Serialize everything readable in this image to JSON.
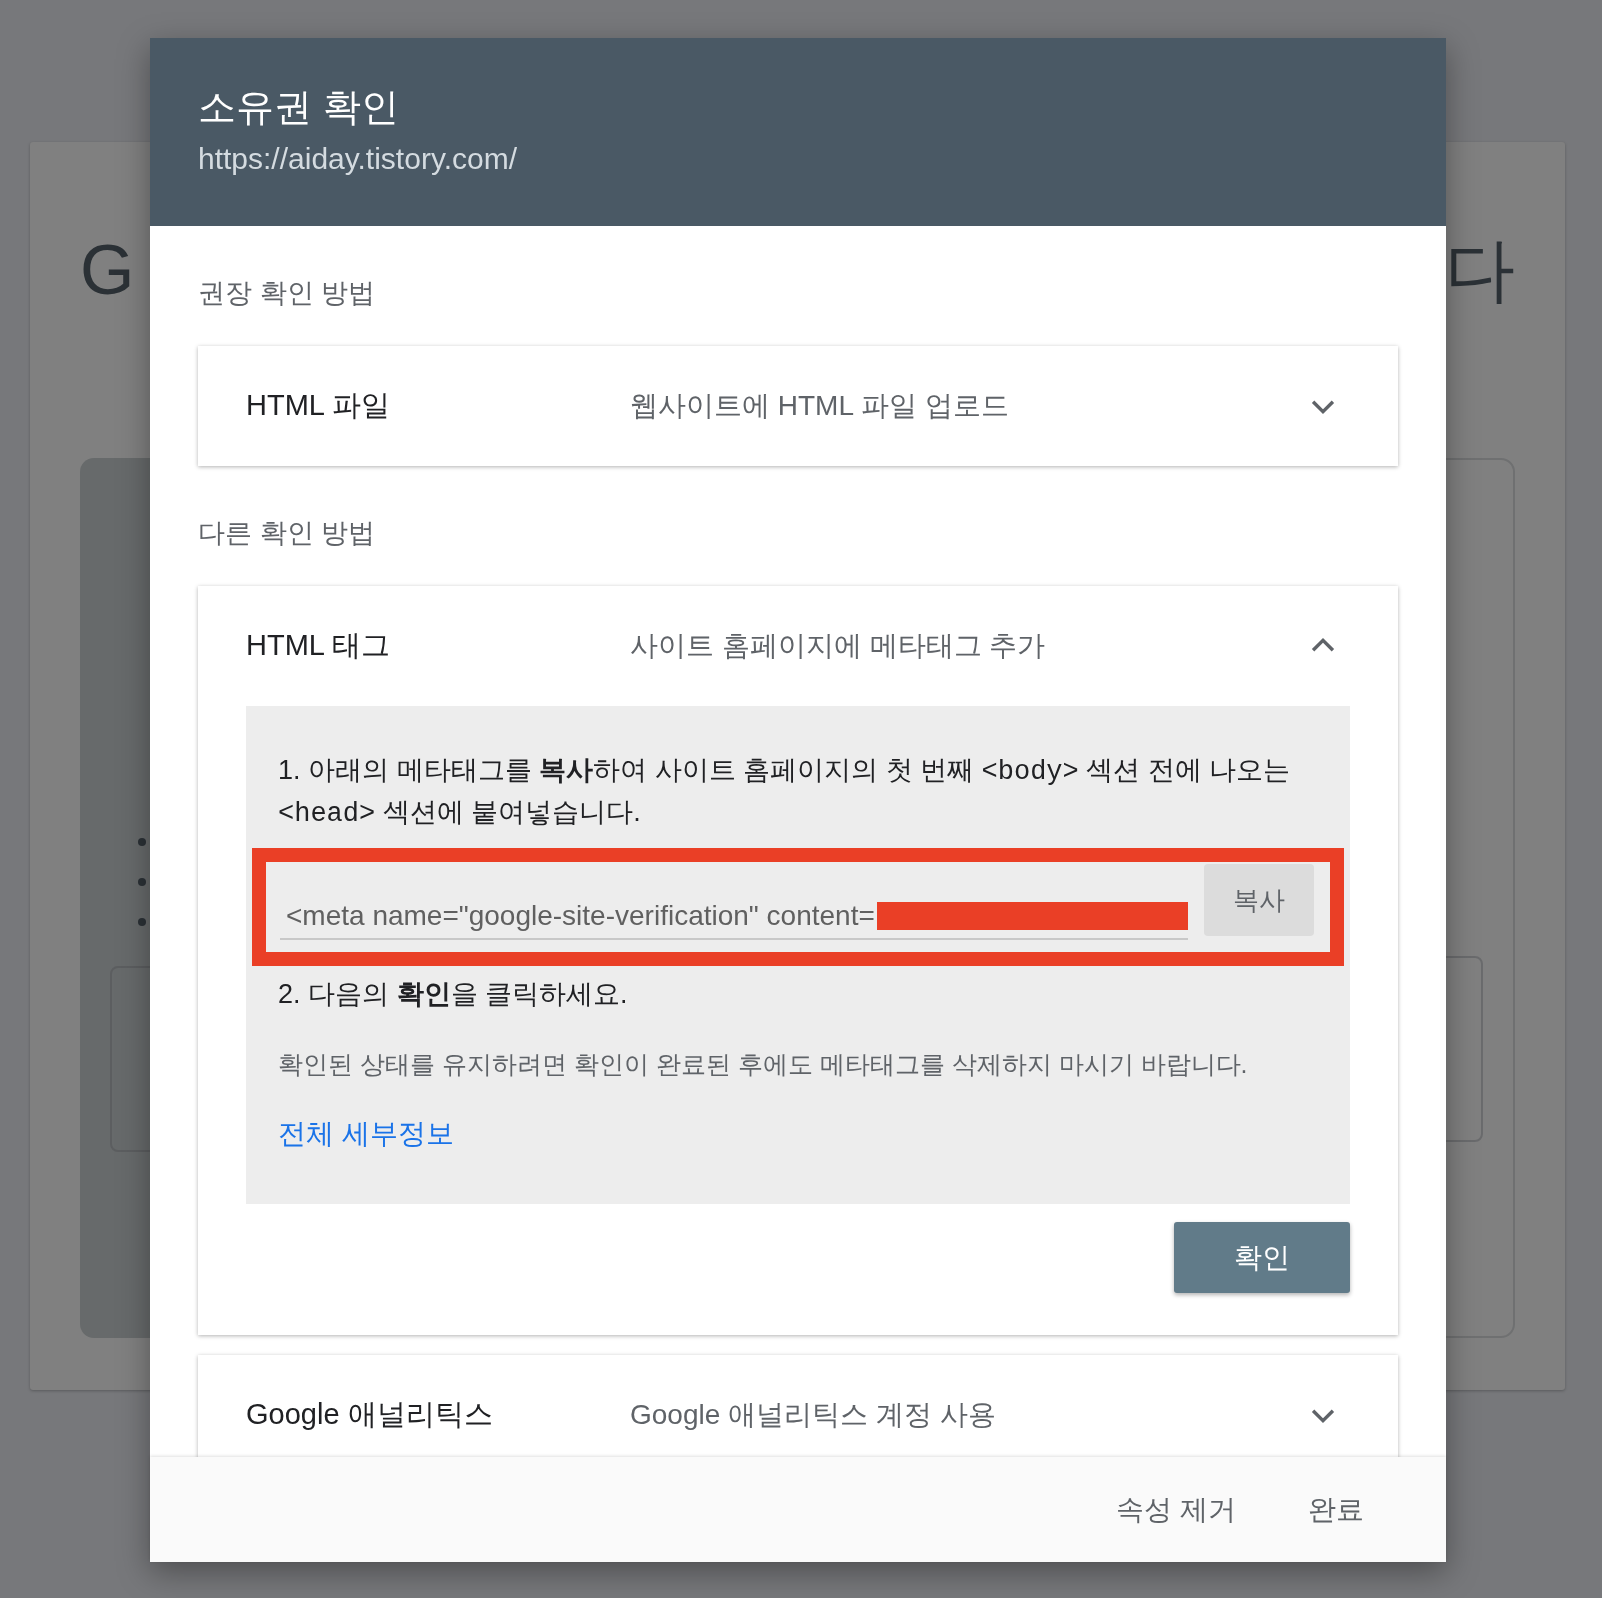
{
  "background_page": {
    "title_start": "G",
    "title_end": "다"
  },
  "dialog": {
    "title": "소유권 확인",
    "url": "https://aiday.tistory.com/",
    "sections": [
      {
        "label": "권장 확인 방법",
        "methods": [
          {
            "title": "HTML 파일",
            "description": "웹사이트에 HTML 파일 업로드",
            "expanded": false
          }
        ]
      },
      {
        "label": "다른 확인 방법",
        "methods": [
          {
            "title": "HTML 태그",
            "description": "사이트 홈페이지에 메타태그 추가",
            "expanded": true,
            "details": {
              "step_1": [
                {
                  "kind": "plain",
                  "text": "1. 아래의 메타태그를 "
                },
                {
                  "kind": "bold",
                  "text": "복사"
                },
                {
                  "kind": "plain",
                  "text": "하여 사이트 홈페이지의 첫 번째 "
                },
                {
                  "kind": "code",
                  "text": "<body>"
                },
                {
                  "kind": "plain",
                  "text": " 섹션 전에 나오는 "
                },
                {
                  "kind": "code",
                  "text": "<head>"
                },
                {
                  "kind": "plain",
                  "text": " 섹션에 붙여넣습니다."
                }
              ],
              "meta_field": {
                "value": "<meta name=\"google-site-verification\" content=",
                "redacted": true,
                "highlighted": true
              },
              "copy_button": "복사",
              "step_2": "2. 다음의 **확인**을 클릭하세요.",
              "note": "확인된 상태를 유지하려면 확인이 완료된 후에도 메타태그를 삭제하지 마시기 바랍니다.",
              "link": "전체 세부정보",
              "verify_button": "확인"
            }
          },
          {
            "title": "Google 애널리틱스",
            "description": "Google 애널리틱스 계정 사용",
            "expanded": false
          }
        ]
      }
    ],
    "footer_buttons": [
      "속성 제거",
      "완료"
    ]
  }
}
